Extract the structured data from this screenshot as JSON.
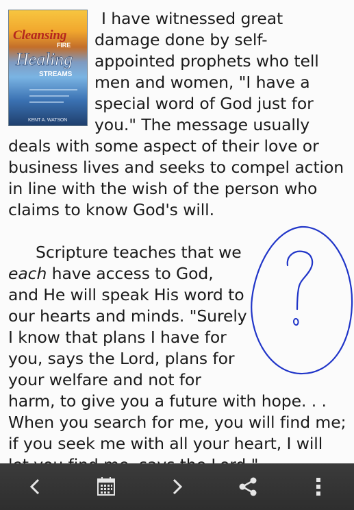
{
  "cover": {
    "title_line1": "Cleansing",
    "title_fire": "FIRE",
    "title_line2": "Healing",
    "title_line3": "STREAMS",
    "author": "KENT A. WATSON"
  },
  "article": {
    "paragraph1": "I have witnessed great damage done by self-appointed prophets who tell men and women, \"I have a special word of God just for you.\" The message usually deals with some aspect of their love or business lives and seeks to compel action in line with the wish of the person who claims to know God's will.",
    "paragraph2_intro": "Scripture teaches that we ",
    "paragraph2_emph": "each",
    "paragraph2_rest": " have access to God, and He will speak His word to our hearts and minds. \"Surely I know that plans I have for you, says the Lord, plans for your welfare and not for harm, to give you a future with hope. . . When you search for me, you will find me; if you seek me with all your heart, I will let you find me, says the Lord.\""
  },
  "annotation": {
    "description_icon": "handwritten-question-mark-circle"
  },
  "toolbar": {
    "icons": [
      "chevron-left-icon",
      "calendar-icon",
      "chevron-right-icon",
      "share-icon",
      "overflow-menu-icon"
    ],
    "background": "#333333",
    "icon_color": "#e6e6e6"
  },
  "colors": {
    "ink": "#1a1a1a",
    "annotation_ink": "#2035c8"
  }
}
